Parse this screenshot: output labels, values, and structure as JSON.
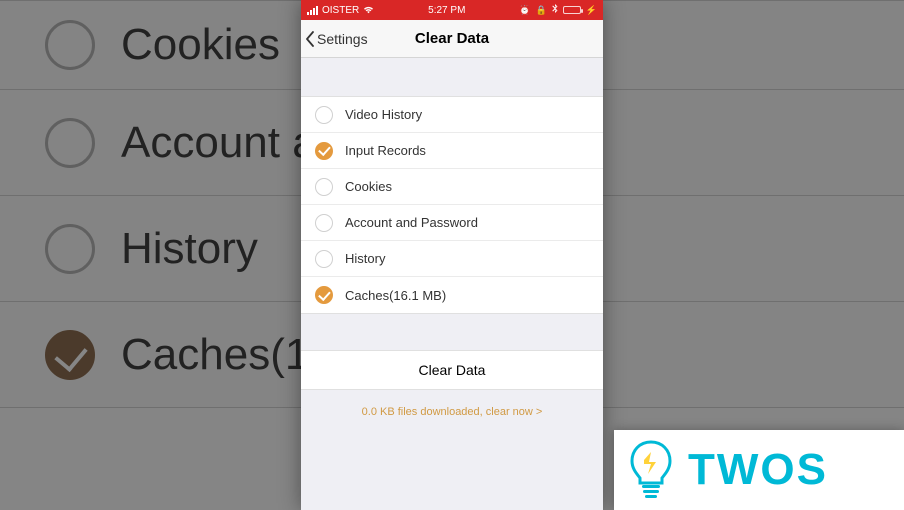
{
  "background": {
    "rows": [
      {
        "label": "Cookies",
        "checked": false
      },
      {
        "label": "Account an",
        "checked": false
      },
      {
        "label": "History",
        "checked": false
      },
      {
        "label": "Caches(16",
        "checked": true
      }
    ]
  },
  "statusbar": {
    "carrier": "OISTER",
    "time": "5:27 PM"
  },
  "navbar": {
    "back_label": "Settings",
    "title": "Clear Data"
  },
  "options": [
    {
      "label": "Video History",
      "checked": false
    },
    {
      "label": "Input Records",
      "checked": true
    },
    {
      "label": "Cookies",
      "checked": false
    },
    {
      "label": "Account and Password",
      "checked": false
    },
    {
      "label": "History",
      "checked": false
    },
    {
      "label": "Caches(16.1 MB)",
      "checked": true
    }
  ],
  "action": {
    "clear_label": "Clear Data",
    "download_link": "0.0 KB files downloaded, clear now >"
  },
  "logo": {
    "text": "TWOS"
  }
}
